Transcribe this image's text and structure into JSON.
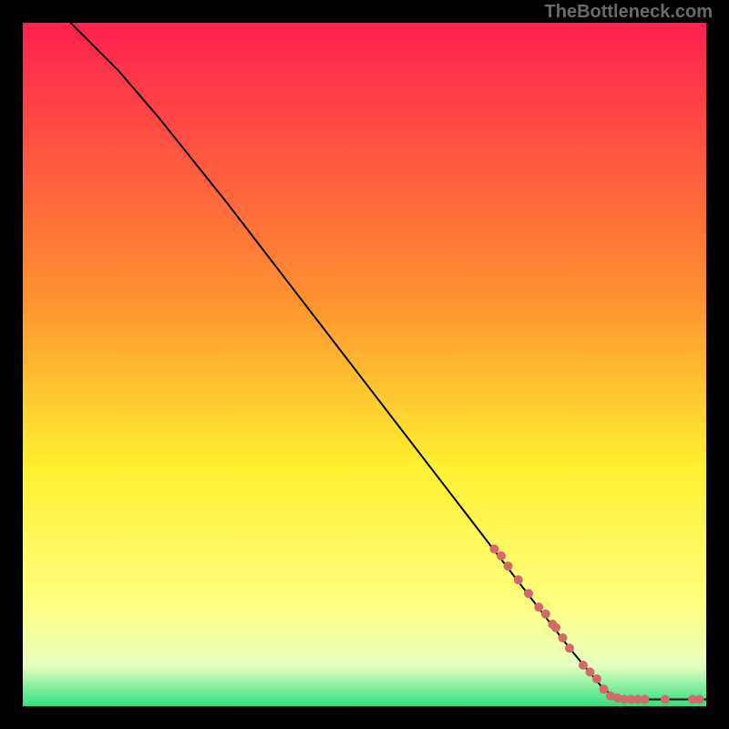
{
  "watermark": "TheBottleneck.com",
  "chart_data": {
    "type": "line",
    "title": "",
    "xlabel": "",
    "ylabel": "",
    "xlim": [
      0,
      100
    ],
    "ylim": [
      0,
      100
    ],
    "background_gradient": {
      "top": "#ff2050",
      "mid1": "#ff9030",
      "mid2": "#fff030",
      "low": "#ffff80",
      "lower": "#e8ffc0",
      "bottom": "#30e080"
    },
    "curve": {
      "color": "#000000",
      "points": [
        {
          "x": 7,
          "y": 100
        },
        {
          "x": 10,
          "y": 97
        },
        {
          "x": 14,
          "y": 93
        },
        {
          "x": 20,
          "y": 86
        },
        {
          "x": 30,
          "y": 73.5
        },
        {
          "x": 40,
          "y": 60.5
        },
        {
          "x": 50,
          "y": 47.5
        },
        {
          "x": 60,
          "y": 34.5
        },
        {
          "x": 70,
          "y": 21.5
        },
        {
          "x": 80,
          "y": 8.5
        },
        {
          "x": 85,
          "y": 2.5
        },
        {
          "x": 87,
          "y": 1.2
        },
        {
          "x": 90,
          "y": 1.0
        },
        {
          "x": 95,
          "y": 1.0
        },
        {
          "x": 100,
          "y": 1.0
        }
      ]
    },
    "markers": {
      "color": "#d26a6a",
      "radius": 5,
      "points": [
        {
          "x": 69,
          "y": 23
        },
        {
          "x": 70,
          "y": 22
        },
        {
          "x": 71,
          "y": 20.5
        },
        {
          "x": 72.5,
          "y": 18.5
        },
        {
          "x": 74,
          "y": 16.5
        },
        {
          "x": 75.5,
          "y": 14.5
        },
        {
          "x": 76.5,
          "y": 13.5
        },
        {
          "x": 77.5,
          "y": 12
        },
        {
          "x": 78,
          "y": 11.5
        },
        {
          "x": 79,
          "y": 10
        },
        {
          "x": 80,
          "y": 8.5
        },
        {
          "x": 82,
          "y": 6
        },
        {
          "x": 83,
          "y": 5
        },
        {
          "x": 84,
          "y": 4
        },
        {
          "x": 85,
          "y": 2.5
        },
        {
          "x": 86,
          "y": 1.5
        },
        {
          "x": 87,
          "y": 1.2
        },
        {
          "x": 88,
          "y": 1.0
        },
        {
          "x": 89,
          "y": 1.0
        },
        {
          "x": 90,
          "y": 1.0
        },
        {
          "x": 91,
          "y": 1.0
        },
        {
          "x": 94,
          "y": 1.0
        },
        {
          "x": 98,
          "y": 1.0
        },
        {
          "x": 99,
          "y": 1.0
        }
      ]
    }
  }
}
